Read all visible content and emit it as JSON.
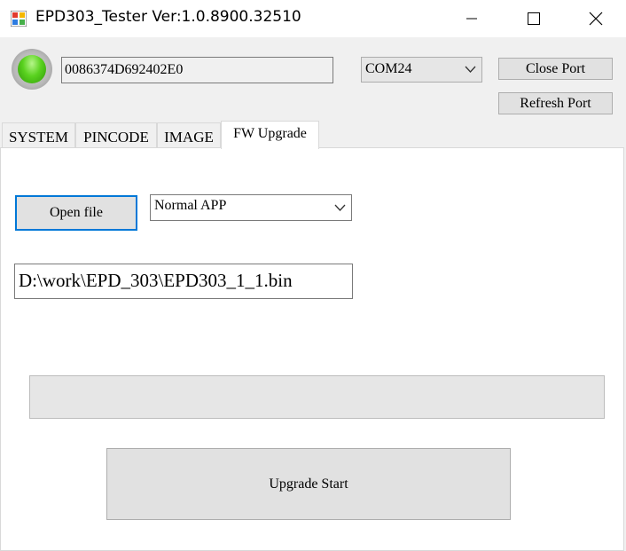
{
  "window": {
    "title": "EPD303_Tester Ver:1.0.8900.32510",
    "controls": [
      "minimize-icon",
      "maximize-icon",
      "close-icon"
    ]
  },
  "connection": {
    "status_led": "green",
    "device_id": "0086374D692402E0",
    "port": "COM24",
    "close_port_label": "Close Port",
    "refresh_port_label": "Refresh Port"
  },
  "tabs": [
    {
      "label": "SYSTEM",
      "active": false
    },
    {
      "label": "PINCODE",
      "active": false
    },
    {
      "label": "IMAGE",
      "active": false
    },
    {
      "label": "FW Upgrade",
      "active": true
    }
  ],
  "fw_upgrade": {
    "open_file_label": "Open file",
    "mode": "Normal APP",
    "file_path": "D:\\work\\EPD_303\\EPD303_1_1.bin",
    "progress": 0,
    "upgrade_start_label": "Upgrade Start"
  },
  "colors": {
    "accent_focus": "#0078d7",
    "led_green": "#5ad21f",
    "progress_fill": "#06b025"
  }
}
